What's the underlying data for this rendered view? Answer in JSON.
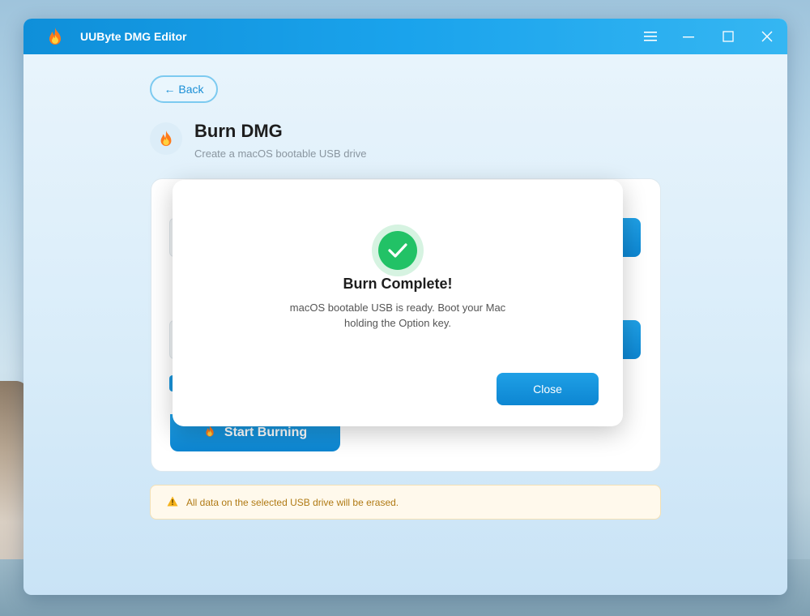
{
  "app": {
    "title": "UUByte DMG Editor"
  },
  "nav": {
    "back_label": "← Back"
  },
  "page": {
    "title": "Burn DMG",
    "subtitle": "Create a macOS bootable USB drive"
  },
  "actions": {
    "start_label": "Start Burning"
  },
  "warning": {
    "text": "All data on the selected USB drive will be erased."
  },
  "modal": {
    "title": "Burn Complete!",
    "message": "macOS bootable USB is ready. Boot your Mac holding the Option key.",
    "close_label": "Close"
  },
  "icons": {
    "app_logo": "flame-icon",
    "menu": "hamburger-icon",
    "minimize": "minimize-icon",
    "maximize": "maximize-icon",
    "close": "close-icon",
    "success": "check-circle-icon",
    "warning": "warning-triangle-icon"
  },
  "colors": {
    "accent": "#1a96dc",
    "success": "#22c266",
    "warning": "#b07a14"
  }
}
